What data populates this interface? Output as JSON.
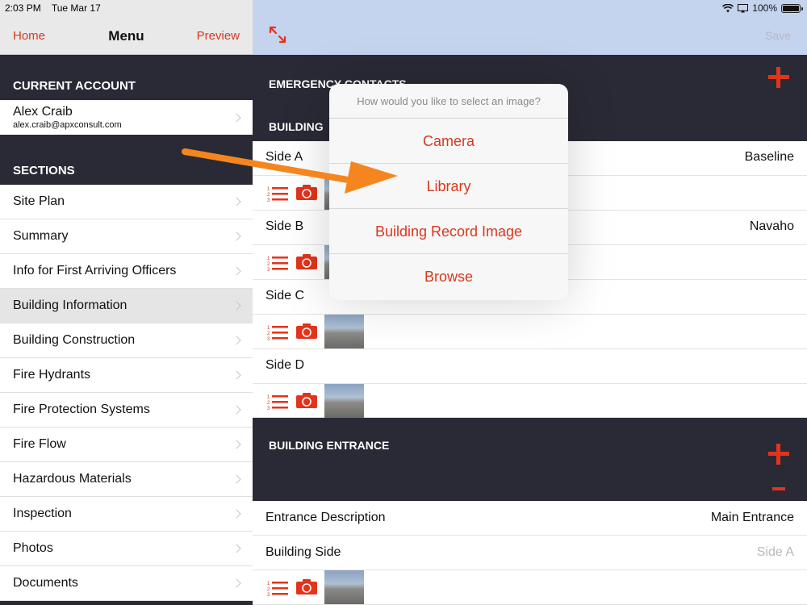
{
  "status_bar": {
    "time": "2:03 PM",
    "date": "Tue Mar 17",
    "battery": "100%",
    "battery_level": 1.0
  },
  "left_nav": {
    "home": "Home",
    "title": "Menu",
    "preview": "Preview"
  },
  "current_account": {
    "header": "CURRENT ACCOUNT",
    "name": "Alex Craib",
    "email": "alex.craib@apxconsult.com"
  },
  "sections": {
    "header": "SECTIONS",
    "items": [
      {
        "label": "Site Plan"
      },
      {
        "label": "Summary"
      },
      {
        "label": "Info for First Arriving Officers"
      },
      {
        "label": "Building Information"
      },
      {
        "label": "Building Construction"
      },
      {
        "label": "Fire Hydrants"
      },
      {
        "label": "Fire Protection Systems"
      },
      {
        "label": "Fire Flow"
      },
      {
        "label": "Hazardous Materials"
      },
      {
        "label": "Inspection"
      },
      {
        "label": "Photos"
      },
      {
        "label": "Documents"
      }
    ]
  },
  "right_nav": {
    "save": "Save"
  },
  "emergency_contacts": {
    "header": "EMERGENCY CONTACTS"
  },
  "building": {
    "header": "BUILDING",
    "sides": [
      {
        "label": "Side A",
        "value": "Baseline"
      },
      {
        "label": "Side B",
        "value": "Navaho"
      },
      {
        "label": "Side C",
        "value": ""
      },
      {
        "label": "Side D",
        "value": ""
      }
    ]
  },
  "building_entrance": {
    "header": "BUILDING ENTRANCE",
    "entrance_description_label": "Entrance Description",
    "entrance_description_value": "Main Entrance",
    "building_side_label": "Building Side",
    "building_side_placeholder": "Side A"
  },
  "image_popover": {
    "title": "How would you like to select an image?",
    "options": [
      "Camera",
      "Library",
      "Building Record Image",
      "Browse"
    ]
  },
  "colors": {
    "accent": "#d9381e",
    "dark_bg": "#2a2a36",
    "arrow": "#f5861f"
  },
  "icons": {
    "expand": "expand-arrows-icon",
    "list": "numbered-list-icon",
    "camera": "camera-icon",
    "chevron": "chevron-right-icon",
    "plus": "plus-icon",
    "minus": "minus-icon"
  }
}
